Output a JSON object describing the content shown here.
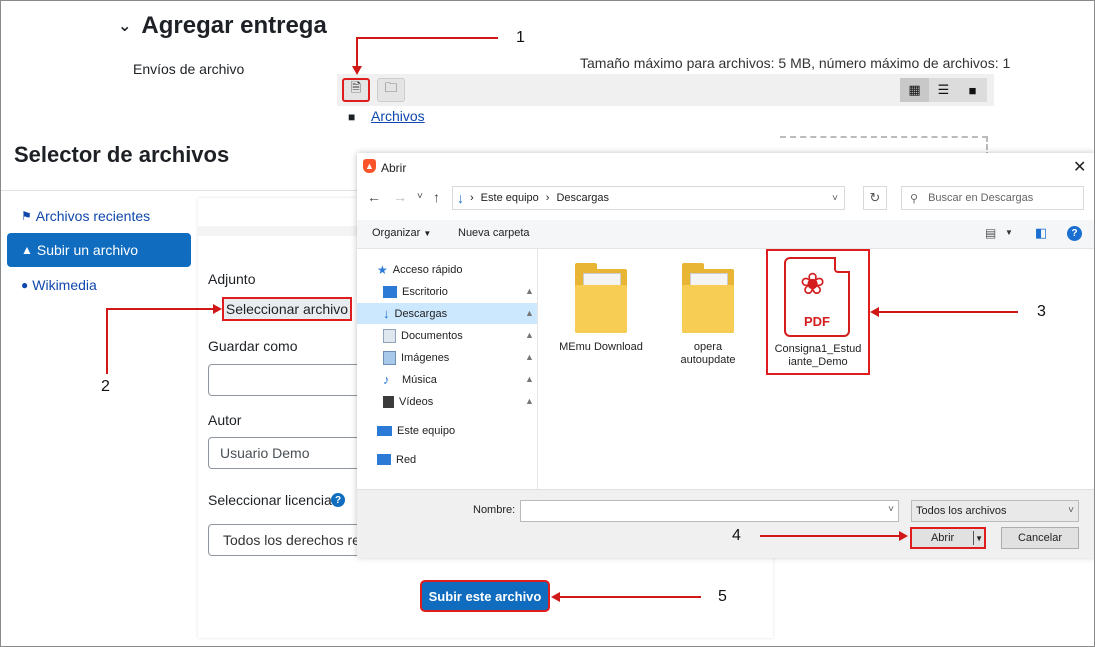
{
  "assignment": {
    "heading": "Agregar entrega",
    "submissions_label": "Envíos de archivo",
    "max_size": "Tamaño máximo para archivos: 5 MB, número máximo de archivos: 1",
    "breadcrumb": "Archivos"
  },
  "picker": {
    "title": "Selector de archivos",
    "nav": [
      {
        "label": "Archivos recientes",
        "icon": "recent-files-icon"
      },
      {
        "label": "Subir un archivo",
        "icon": "upload-icon"
      },
      {
        "label": "Wikimedia",
        "icon": "wikimedia-icon"
      }
    ],
    "attachment_label": "Adjunto",
    "select_file_button": "Seleccionar archivo",
    "save_as_label": "Guardar como",
    "save_as_value": "",
    "author_label": "Autor",
    "author_value": "Usuario Demo",
    "license_label": "Seleccionar licencia",
    "license_value": "Todos los derechos res",
    "upload_button": "Subir este archivo"
  },
  "dialog": {
    "title": "Abrir",
    "address": [
      "Este equipo",
      "Descargas"
    ],
    "search_placeholder": "Buscar en Descargas",
    "toolbar": {
      "organize": "Organizar",
      "new_folder": "Nueva carpeta"
    },
    "tree": [
      {
        "label": "Acceso rápido",
        "icon": "star-icon",
        "pinned": false
      },
      {
        "label": "Escritorio",
        "icon": "desktop-icon",
        "pinned": true
      },
      {
        "label": "Descargas",
        "icon": "download-icon",
        "pinned": true
      },
      {
        "label": "Documentos",
        "icon": "documents-icon",
        "pinned": true
      },
      {
        "label": "Imágenes",
        "icon": "pictures-icon",
        "pinned": true
      },
      {
        "label": "Música",
        "icon": "music-icon",
        "pinned": true
      },
      {
        "label": "Vídeos",
        "icon": "videos-icon",
        "pinned": true
      },
      {
        "label": "Este equipo",
        "icon": "computer-icon",
        "pinned": false
      },
      {
        "label": "Red",
        "icon": "network-icon",
        "pinned": false
      }
    ],
    "files": [
      {
        "name": "MEmu Download",
        "type": "folder"
      },
      {
        "name_line1": "opera",
        "name_line2": "autoupdate",
        "type": "folder"
      },
      {
        "name_line1": "Consigna1_Estud",
        "name_line2": "iante_Demo",
        "type": "pdf",
        "badge": "PDF"
      }
    ],
    "name_label": "Nombre:",
    "name_value": "",
    "filetype": "Todos los archivos",
    "open_button": "Abrir",
    "cancel_button": "Cancelar"
  },
  "annotations": [
    "1",
    "2",
    "3",
    "4",
    "5"
  ],
  "colors": {
    "accent": "#0f6cbf",
    "highlight": "#e01d1d",
    "link": "#0f47ad"
  }
}
